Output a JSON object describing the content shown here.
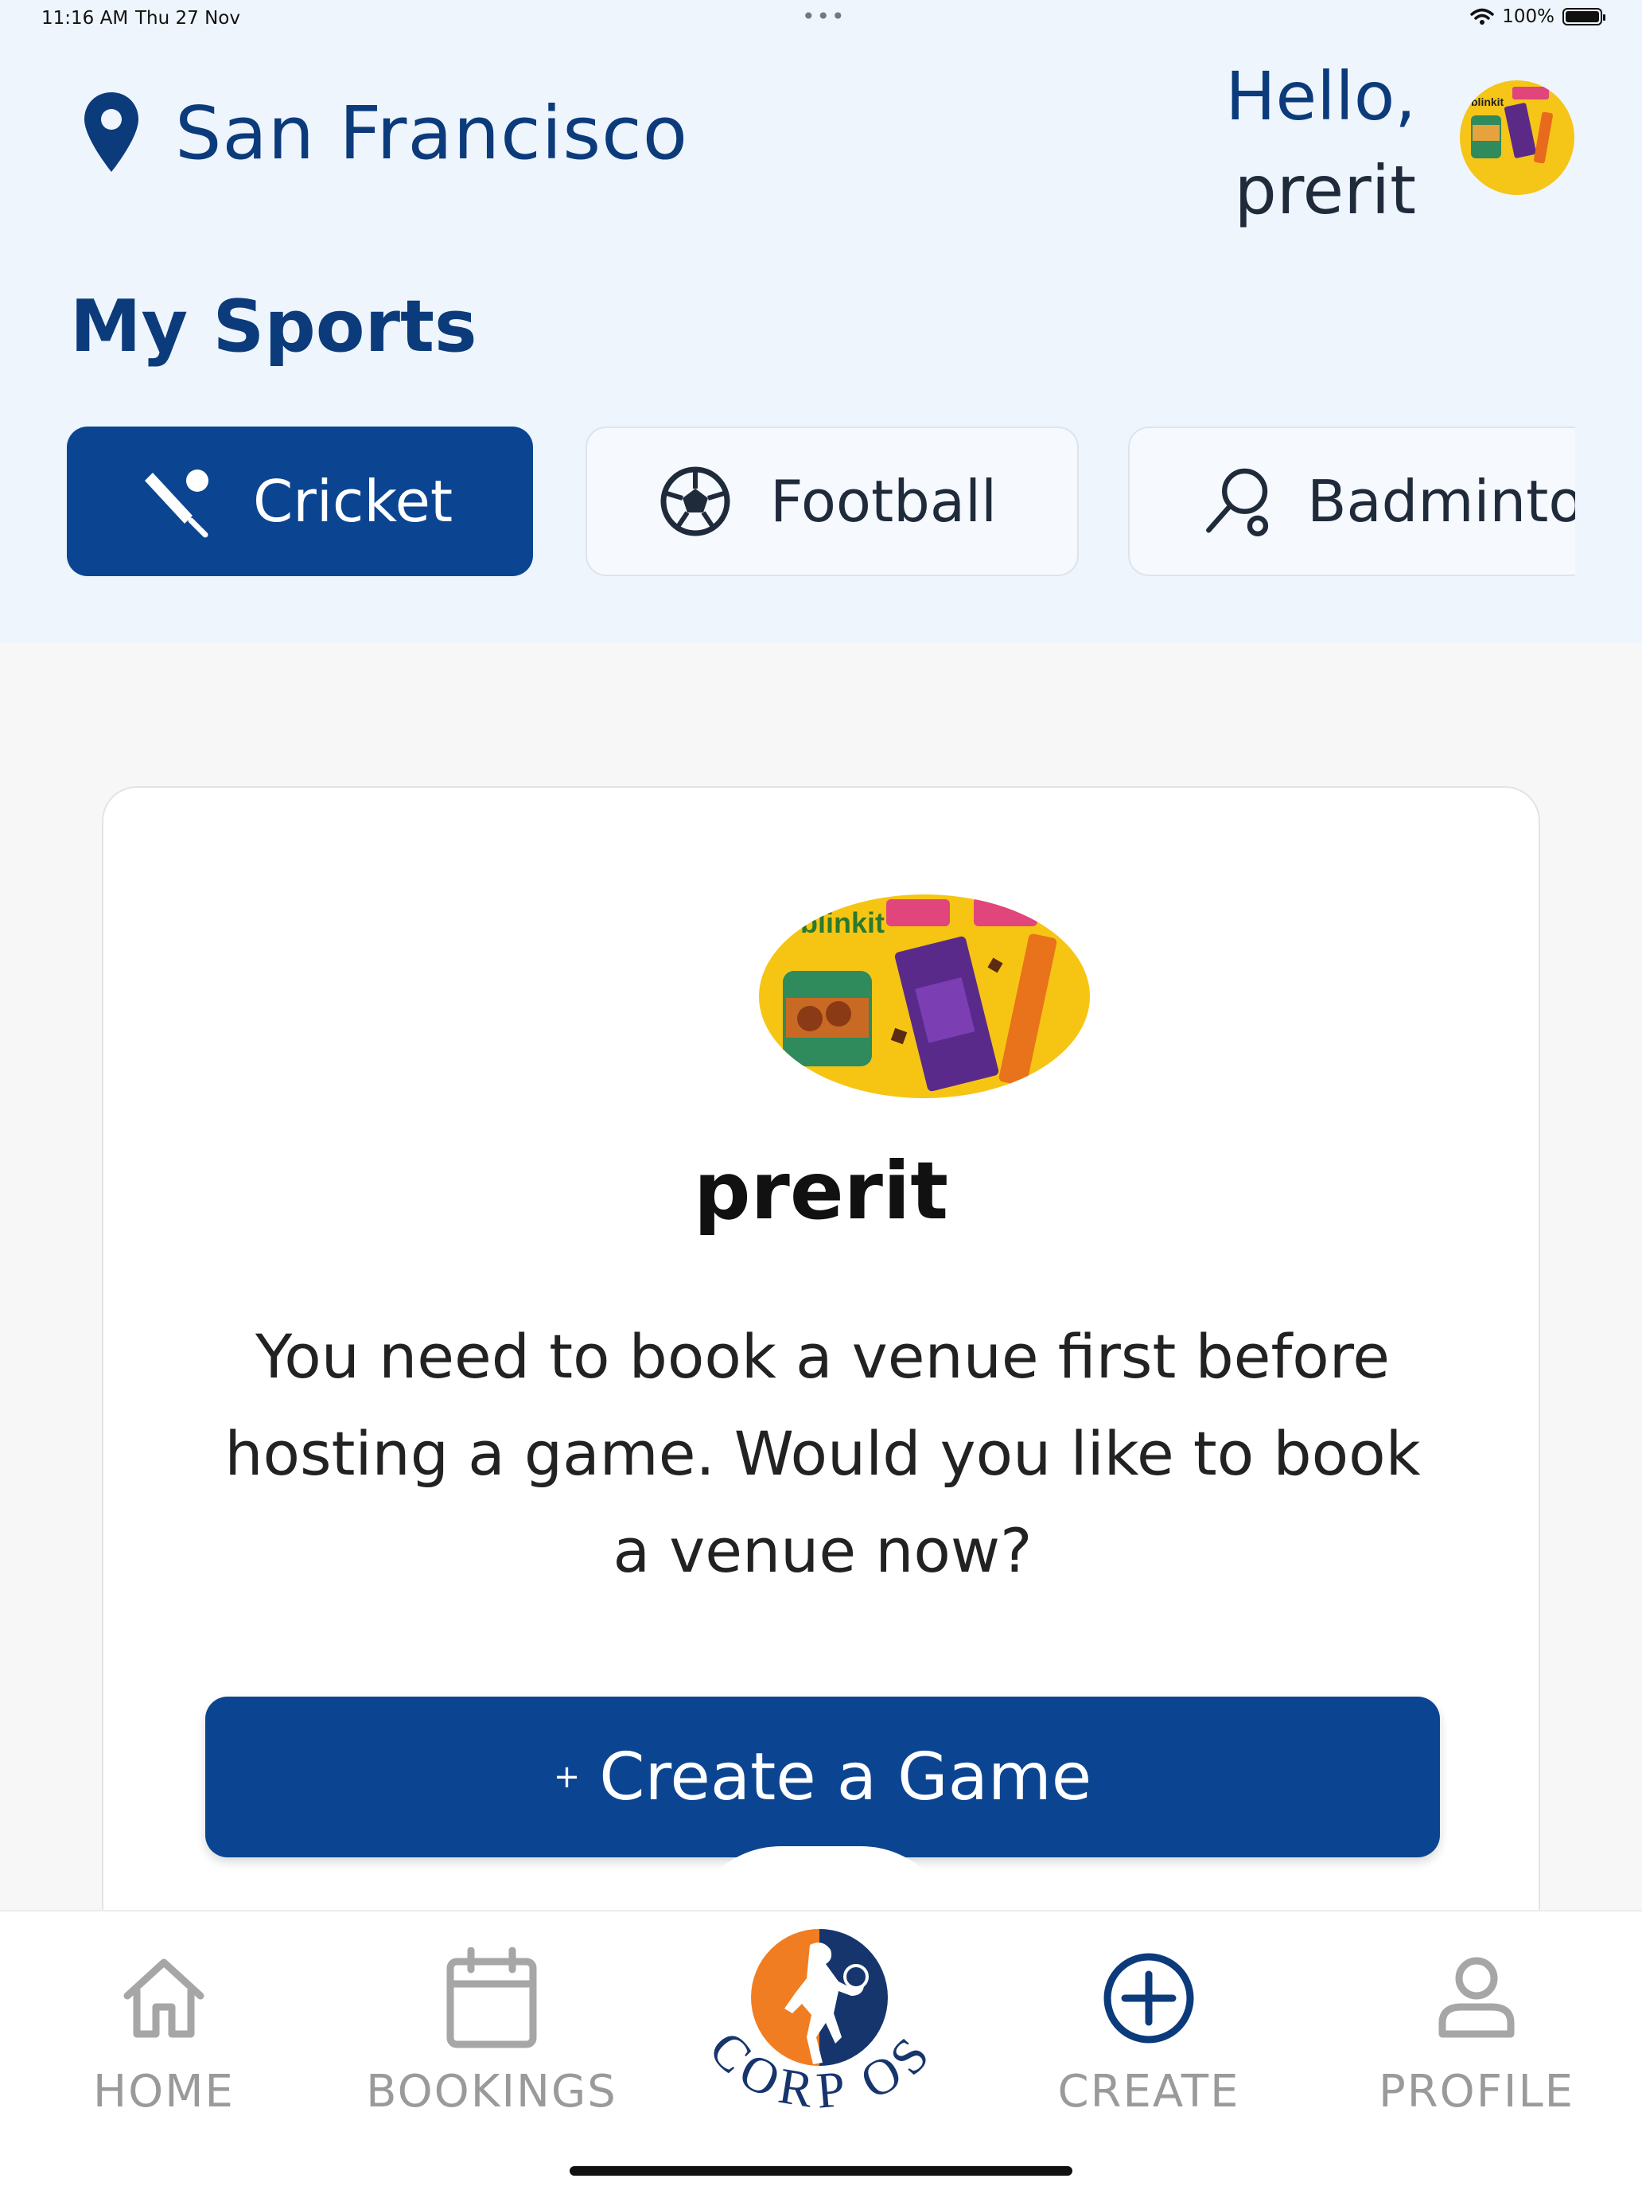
{
  "status_bar": {
    "time": "11:16 AM",
    "date": "Thu 27 Nov",
    "battery": "100%"
  },
  "header": {
    "location": "San Francisco",
    "greeting_line1": "Hello,",
    "greeting_line2": "prerit",
    "avatar_icon": "profile-photo-chocolates"
  },
  "sports": {
    "title": "My Sports",
    "chips": [
      {
        "label": "Cricket",
        "icon": "cricket-bat-icon",
        "active": true
      },
      {
        "label": "Football",
        "icon": "football-icon",
        "active": false
      },
      {
        "label": "Badminton",
        "icon": "badminton-racket-icon",
        "active": false
      }
    ]
  },
  "card": {
    "name": "prerit",
    "message": "You need to book a venue first before hosting a game. Would you like to book a venue now?",
    "cta_plus": "+",
    "cta_label": "Create a Game"
  },
  "tabbar": {
    "items": [
      {
        "label": "HOME",
        "icon": "home-icon"
      },
      {
        "label": "BOOKINGS",
        "icon": "calendar-icon"
      },
      {
        "label": "CORP OS",
        "icon": "corp-os-logo"
      },
      {
        "label": "CREATE",
        "icon": "plus-circle-icon",
        "active": true
      },
      {
        "label": "PROFILE",
        "icon": "person-icon"
      }
    ]
  },
  "colors": {
    "primary": "#0b4591",
    "title": "#0c3b7c",
    "header_bg": "#eef5fc",
    "inactive": "#9a9a9a",
    "logo_orange": "#f07d22"
  }
}
